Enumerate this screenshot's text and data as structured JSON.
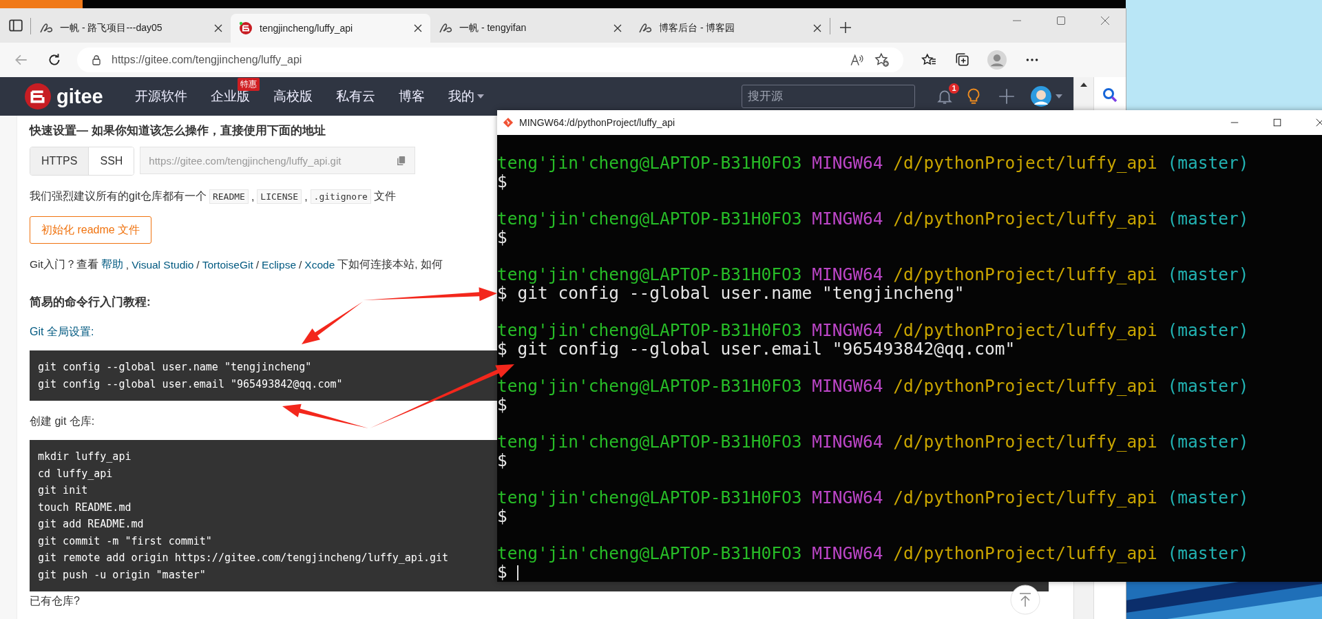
{
  "browser": {
    "tabs": [
      {
        "title": "一帆 - 路飞项目---day05",
        "kind": "blog",
        "selected": false
      },
      {
        "title": "tengjincheng/luffy_api",
        "kind": "gitee",
        "selected": true
      },
      {
        "title": "一帆 - tengyifan",
        "kind": "blog",
        "selected": false
      },
      {
        "title": "博客后台 - 博客园",
        "kind": "blog",
        "selected": false
      }
    ],
    "address_bar": {
      "url": "https://gitee.com/tengjincheng/luffy_api"
    }
  },
  "gitee": {
    "logo": "gitee",
    "nav": [
      {
        "label": "开源软件",
        "dropdown": false
      },
      {
        "label": "企业版",
        "badge": "特惠",
        "dropdown": false
      },
      {
        "label": "高校版",
        "dropdown": false
      },
      {
        "label": "私有云",
        "dropdown": false
      },
      {
        "label": "博客",
        "dropdown": false
      },
      {
        "label": "我的",
        "dropdown": true
      }
    ],
    "search": {
      "placeholder": "搜开源"
    },
    "notifications": "1"
  },
  "quick_setup": {
    "title": "快速设置— 如果你知道该怎么操作，直接使用下面的地址",
    "protocols": [
      {
        "label": "HTTPS",
        "selected": true
      },
      {
        "label": "SSH",
        "selected": false
      }
    ],
    "clone_url": "https://gitee.com/tengjincheng/luffy_api.git",
    "recommendation": [
      {
        "kind": "text",
        "text": "我们强烈建议所有的git仓库都有一个"
      },
      {
        "kind": "code",
        "text": "README"
      },
      {
        "kind": "text",
        "text": ","
      },
      {
        "kind": "code",
        "text": "LICENSE"
      },
      {
        "kind": "text",
        "text": ","
      },
      {
        "kind": "code",
        "text": ".gitignore"
      },
      {
        "kind": "text",
        "text": "文件"
      }
    ],
    "init_button": "初始化 readme 文件",
    "help": [
      {
        "kind": "text",
        "text": "Git入门？查看"
      },
      {
        "kind": "link",
        "text": "帮助"
      },
      {
        "kind": "text",
        "text": ","
      },
      {
        "kind": "link",
        "text": "Visual Studio"
      },
      {
        "kind": "text",
        "text": "/"
      },
      {
        "kind": "link",
        "text": "TortoiseGit"
      },
      {
        "kind": "text",
        "text": "/"
      },
      {
        "kind": "link",
        "text": "Eclipse"
      },
      {
        "kind": "text",
        "text": "/"
      },
      {
        "kind": "link",
        "text": "Xcode"
      },
      {
        "kind": "text",
        "text": "下如何连接本站, 如何"
      }
    ]
  },
  "tutorial": {
    "title": "简易的命令行入门教程:",
    "sections": [
      {
        "label": "Git 全局设置:",
        "code": [
          "git config --global user.name \"tengjincheng\"",
          "git config --global user.email \"965493842@qq.com\""
        ]
      },
      {
        "label": "创建 git 仓库:",
        "code": [
          "mkdir luffy_api",
          "cd luffy_api",
          "git init",
          "touch README.md",
          "git add README.md",
          "git commit -m \"first commit\"",
          "git remote add origin https://gitee.com/tengjincheng/luffy_api.git",
          "git push -u origin \"master\""
        ]
      }
    ],
    "more": "已有仓库?"
  },
  "terminal": {
    "title": "MINGW64:/d/pythonProject/luffy_api",
    "blocks": [
      {
        "user": "teng'jin'cheng@LAPTOP-B31H0FO3",
        "shell": "MINGW64",
        "path": "/d/pythonProject/luffy_api",
        "branch": "(master)",
        "command": "$",
        "cursor": false
      },
      {
        "user": "teng'jin'cheng@LAPTOP-B31H0FO3",
        "shell": "MINGW64",
        "path": "/d/pythonProject/luffy_api",
        "branch": "(master)",
        "command": "$",
        "cursor": false
      },
      {
        "user": "teng'jin'cheng@LAPTOP-B31H0FO3",
        "shell": "MINGW64",
        "path": "/d/pythonProject/luffy_api",
        "branch": "(master)",
        "command": "$ git config --global user.name \"tengjincheng\"",
        "cursor": false
      },
      {
        "user": "teng'jin'cheng@LAPTOP-B31H0FO3",
        "shell": "MINGW64",
        "path": "/d/pythonProject/luffy_api",
        "branch": "(master)",
        "command": "$ git config --global user.email \"965493842@qq.com\"",
        "cursor": false
      },
      {
        "user": "teng'jin'cheng@LAPTOP-B31H0FO3",
        "shell": "MINGW64",
        "path": "/d/pythonProject/luffy_api",
        "branch": "(master)",
        "command": "$",
        "cursor": false
      },
      {
        "user": "teng'jin'cheng@LAPTOP-B31H0FO3",
        "shell": "MINGW64",
        "path": "/d/pythonProject/luffy_api",
        "branch": "(master)",
        "command": "$",
        "cursor": false
      },
      {
        "user": "teng'jin'cheng@LAPTOP-B31H0FO3",
        "shell": "MINGW64",
        "path": "/d/pythonProject/luffy_api",
        "branch": "(master)",
        "command": "$",
        "cursor": false
      },
      {
        "user": "teng'jin'cheng@LAPTOP-B31H0FO3",
        "shell": "MINGW64",
        "path": "/d/pythonProject/luffy_api",
        "branch": "(master)",
        "command": "$",
        "cursor": true
      }
    ]
  }
}
